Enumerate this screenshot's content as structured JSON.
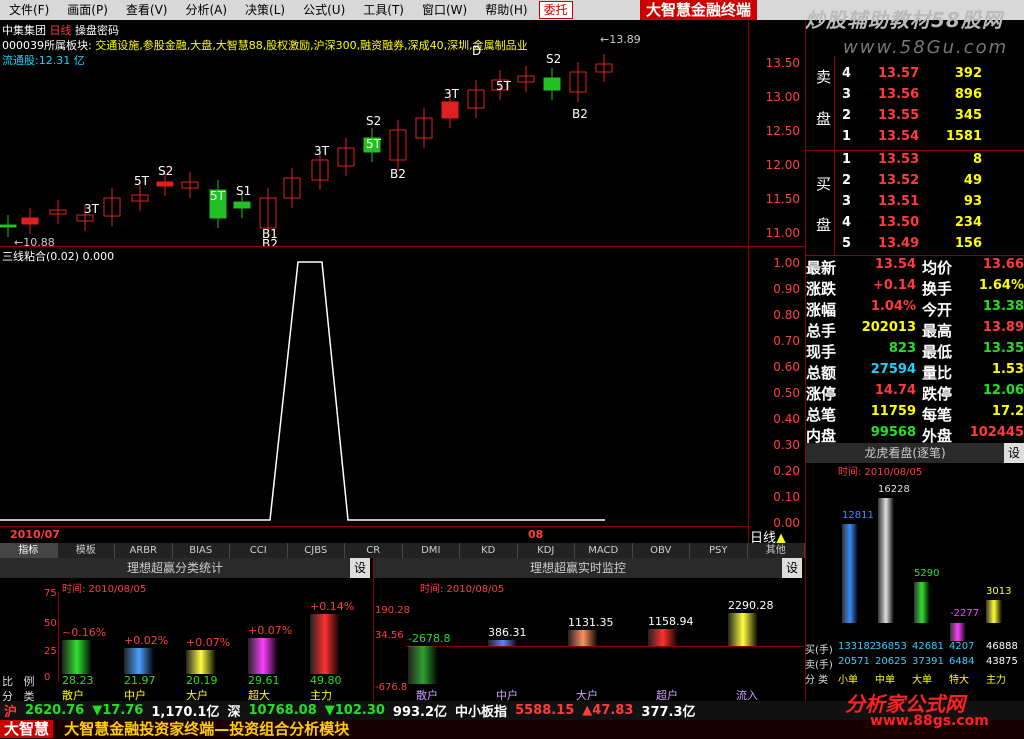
{
  "menu": [
    "文件(F)",
    "画面(P)",
    "查看(V)",
    "分析(A)",
    "决策(L)",
    "公式(U)",
    "工具(T)",
    "窗口(W)",
    "帮助(H)"
  ],
  "menu_trust": "委托",
  "brand": "大智慧金融终端",
  "watermark1": "炒股辅助教材58股网",
  "watermark2": "www.58Gu.com",
  "header": {
    "title": "中集集团",
    "period": "日线",
    "pwd": "操盘密码",
    "sector_label": "000039所属板块:",
    "sectors": "交通设施,参股金融,大盘,大智慧88,股权激励,沪深300,融资融券,深成40,深圳,金属制品业",
    "float": "流通股:12.31 亿"
  },
  "main_axis": [
    "13.50",
    "13.00",
    "12.50",
    "12.00",
    "11.50",
    "11.00"
  ],
  "high_label": "13.89",
  "low_label": "10.88",
  "signals": [
    {
      "t": "S2"
    },
    {
      "t": "5T"
    },
    {
      "t": "3T"
    },
    {
      "t": "S1"
    },
    {
      "t": "5T"
    },
    {
      "t": "B1"
    },
    {
      "t": "B2"
    },
    {
      "t": "3T"
    },
    {
      "t": "S2"
    },
    {
      "t": "5T"
    },
    {
      "t": "B2"
    },
    {
      "t": "3T"
    },
    {
      "t": "D"
    },
    {
      "t": "5T"
    },
    {
      "t": "S2"
    },
    {
      "t": "B2"
    }
  ],
  "indicator": {
    "label": "三线粘合(0.02) 0.000",
    "axis": [
      "1.00",
      "0.90",
      "0.80",
      "0.70",
      "0.60",
      "0.50",
      "0.40",
      "0.30",
      "0.20",
      "0.10",
      "0.00"
    ]
  },
  "dates": {
    "left": "2010/07",
    "right": "08",
    "period_tag": "日线"
  },
  "tabs": [
    "指标",
    "模板",
    "ARBR",
    "BIAS",
    "CCI",
    "CJBS",
    "CR",
    "DMI",
    "KD",
    "KDJ",
    "MACD",
    "OBV",
    "PSY",
    "其他"
  ],
  "panel1": {
    "title": "理想超赢分类统计",
    "time": "时间: 2010/08/05",
    "set": "设",
    "axis": [
      "75",
      "50",
      "25",
      "0"
    ],
    "bars": [
      {
        "top": "~0.16%",
        "val": "28.23",
        "name": "散户",
        "color": "#30e030"
      },
      {
        "top": "+0.02%",
        "val": "21.97",
        "name": "中户",
        "color": "#4aa0ff"
      },
      {
        "top": "+0.07%",
        "val": "20.19",
        "name": "大户",
        "color": "#ffff40"
      },
      {
        "top": "+0.07%",
        "val": "29.61",
        "name": "超大",
        "color": "#ff40ff"
      },
      {
        "top": "+0.14%",
        "val": "49.80",
        "name": "主力",
        "color": "#ff3030"
      }
    ],
    "row_label1": "比",
    "row_label2": "例",
    "row_label3": "分",
    "row_label4": "类"
  },
  "panel2": {
    "title": "理想超赢实时监控",
    "time": "时间: 2010/08/05",
    "set": "设",
    "axis": [
      "190.28",
      "34.56",
      "-676.8"
    ],
    "bars": [
      {
        "val": "-2678.8",
        "name": "散户",
        "color": "#30a030"
      },
      {
        "val": "386.31",
        "name": "中户",
        "color": "#6080ff"
      },
      {
        "val": "1131.35",
        "name": "大户",
        "color": "#ff9060"
      },
      {
        "val": "1158.94",
        "name": "超户",
        "color": "#ff3030"
      },
      {
        "val": "2290.28",
        "name": "流入",
        "color": "#ffff40"
      }
    ]
  },
  "orderbook": {
    "sell_label": [
      "卖",
      "盘"
    ],
    "buy_label": [
      "买",
      "盘"
    ],
    "sells": [
      {
        "n": "4",
        "p": "13.57",
        "v": "392"
      },
      {
        "n": "3",
        "p": "13.56",
        "v": "896"
      },
      {
        "n": "2",
        "p": "13.55",
        "v": "345"
      },
      {
        "n": "1",
        "p": "13.54",
        "v": "1581"
      }
    ],
    "buys": [
      {
        "n": "1",
        "p": "13.53",
        "v": "8"
      },
      {
        "n": "2",
        "p": "13.52",
        "v": "49"
      },
      {
        "n": "3",
        "p": "13.51",
        "v": "93"
      },
      {
        "n": "4",
        "p": "13.50",
        "v": "234"
      },
      {
        "n": "5",
        "p": "13.49",
        "v": "156"
      }
    ]
  },
  "quote": [
    {
      "l": "最新",
      "v": "13.54",
      "c": "red",
      "l2": "均价",
      "v2": "13.66",
      "c2": "red"
    },
    {
      "l": "涨跌",
      "v": "+0.14",
      "c": "red",
      "l2": "换手",
      "v2": "1.64%",
      "c2": "yel"
    },
    {
      "l": "涨幅",
      "v": "1.04%",
      "c": "red",
      "l2": "今开",
      "v2": "13.38",
      "c2": "green"
    },
    {
      "l": "总手",
      "v": "202013",
      "c": "yel",
      "l2": "最高",
      "v2": "13.89",
      "c2": "red"
    },
    {
      "l": "现手",
      "v": "823",
      "c": "green",
      "l2": "最低",
      "v2": "13.35",
      "c2": "green"
    },
    {
      "l": "总额",
      "v": "27594",
      "c": "cyan",
      "l2": "量比",
      "v2": "1.53",
      "c2": "yel"
    },
    {
      "l": "涨停",
      "v": "14.74",
      "c": "red",
      "l2": "跌停",
      "v2": "12.06",
      "c2": "green"
    },
    {
      "l": "总笔",
      "v": "11759",
      "c": "yel",
      "l2": "每笔",
      "v2": "17.2",
      "c2": "yel"
    },
    {
      "l": "内盘",
      "v": "99568",
      "c": "green",
      "l2": "外盘",
      "v2": "102445",
      "c2": "red"
    }
  ],
  "dragon": {
    "title": "龙虎看盘(逐笔)",
    "set": "设",
    "time": "时间: 2010/08/05",
    "bars": [
      {
        "top": "12811",
        "color": "#3a8cff"
      },
      {
        "top": "16228",
        "color": "#e0e0e0"
      },
      {
        "top": "5290",
        "color": "#30e030"
      },
      {
        "top": "-2277",
        "color": "#ff40ff"
      },
      {
        "top": "3013",
        "color": "#ffff30"
      }
    ],
    "buy_label": "买(手)",
    "sell_label": "卖(手)",
    "buy_vals": [
      "133182",
      "36853",
      "42681",
      "4207",
      "46888"
    ],
    "sell_vals": [
      "20571",
      "20625",
      "37391",
      "6484",
      "43875"
    ],
    "classes": [
      "小单",
      "中单",
      "大单",
      "特大",
      "主力"
    ],
    "row_label": "分 类"
  },
  "status": {
    "sh_label": "沪",
    "sh": "2620.76",
    "sh_chg": "▼17.76",
    "sh_amt": "1,170.1亿",
    "sz_label": "深",
    "sz": "10768.08",
    "sz_chg": "▼102.30",
    "sz_amt": "993.2亿",
    "sme_label": "中小板指",
    "sme": "5588.15",
    "sme_chg": "▲47.83",
    "sme_amt": "377.3亿"
  },
  "footer": {
    "logo": "大智慧",
    "text": "大智慧金融投资家终端—投资组合分析模块"
  },
  "watermark3": "分析家公式网",
  "watermark4": "www.88gs.com"
}
